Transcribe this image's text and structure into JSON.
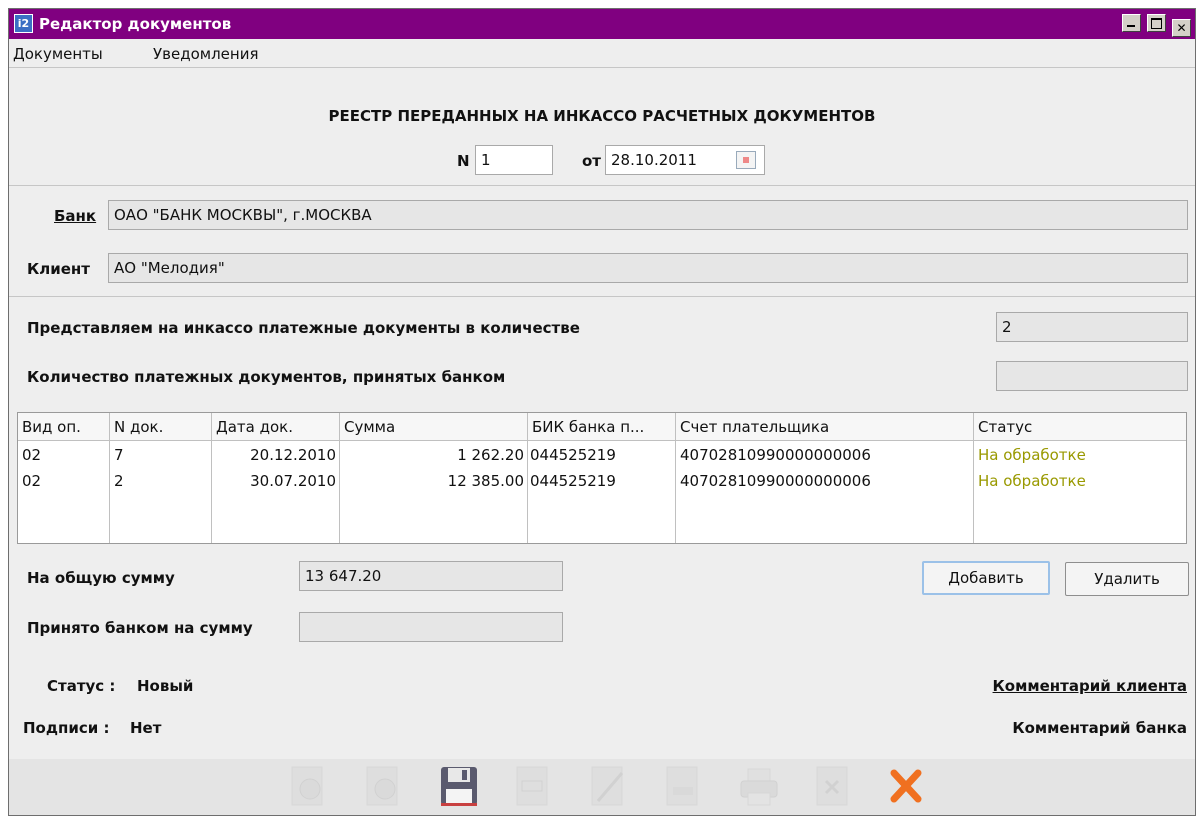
{
  "window": {
    "title": "Редактор документов",
    "app_icon_text": "i2",
    "controls": [
      "minimize",
      "maximize",
      "close"
    ]
  },
  "menu": [
    "Документы",
    "Уведомления"
  ],
  "header": {
    "title": "РЕЕСТР ПЕРЕДАННЫХ НА ИНКАССО РАСЧЕТНЫХ ДОКУМЕНТОВ",
    "number_label": "N",
    "number_value": "1",
    "date_label": "от",
    "date_value": "28.10.2011"
  },
  "bank": {
    "label": "Банк",
    "value": "ОАО \"БАНК МОСКВЫ\", г.МОСКВА"
  },
  "client": {
    "label": "Клиент",
    "value": "АО \"Мелодия\""
  },
  "counts": {
    "presented_label": "Представляем на инкассо платежные документы в количестве",
    "presented_value": "2",
    "accepted_label": "Количество платежных документов, принятых банком",
    "accepted_value": ""
  },
  "table": {
    "columns": [
      "Вид оп.",
      "N док.",
      "Дата док.",
      "Сумма",
      "БИК банка п...",
      "Счет плательщика",
      "Статус"
    ],
    "rows": [
      [
        "02",
        "7",
        "20.12.2010",
        "1 262.20",
        "044525219",
        "40702810990000000006",
        "На обработке"
      ],
      [
        "02",
        "2",
        "30.07.2010",
        "12 385.00",
        "044525219",
        "40702810990000000006",
        "На обработке"
      ]
    ],
    "status_color": "#999900"
  },
  "totals": {
    "total_label": "На общую сумму",
    "total_value": "13 647.20",
    "accepted_label": "Принято банком на сумму",
    "accepted_value": ""
  },
  "buttons": {
    "add": "Добавить",
    "delete": "Удалить"
  },
  "status": {
    "label": "Статус :",
    "value": "Новый"
  },
  "signatures": {
    "label": "Подписи :",
    "value": "Нет"
  },
  "links": {
    "client_comment": "Комментарий клиента",
    "bank_comment": "Комментарий банка"
  },
  "toolbar": [
    "sign-icon",
    "verify-icon",
    "save-icon",
    "text-doc-icon",
    "edit-icon",
    "copy-icon",
    "print-icon",
    "delete-doc-icon",
    "close-icon"
  ],
  "colors": {
    "titlebar": "#800080",
    "close_x": "#f07020"
  }
}
